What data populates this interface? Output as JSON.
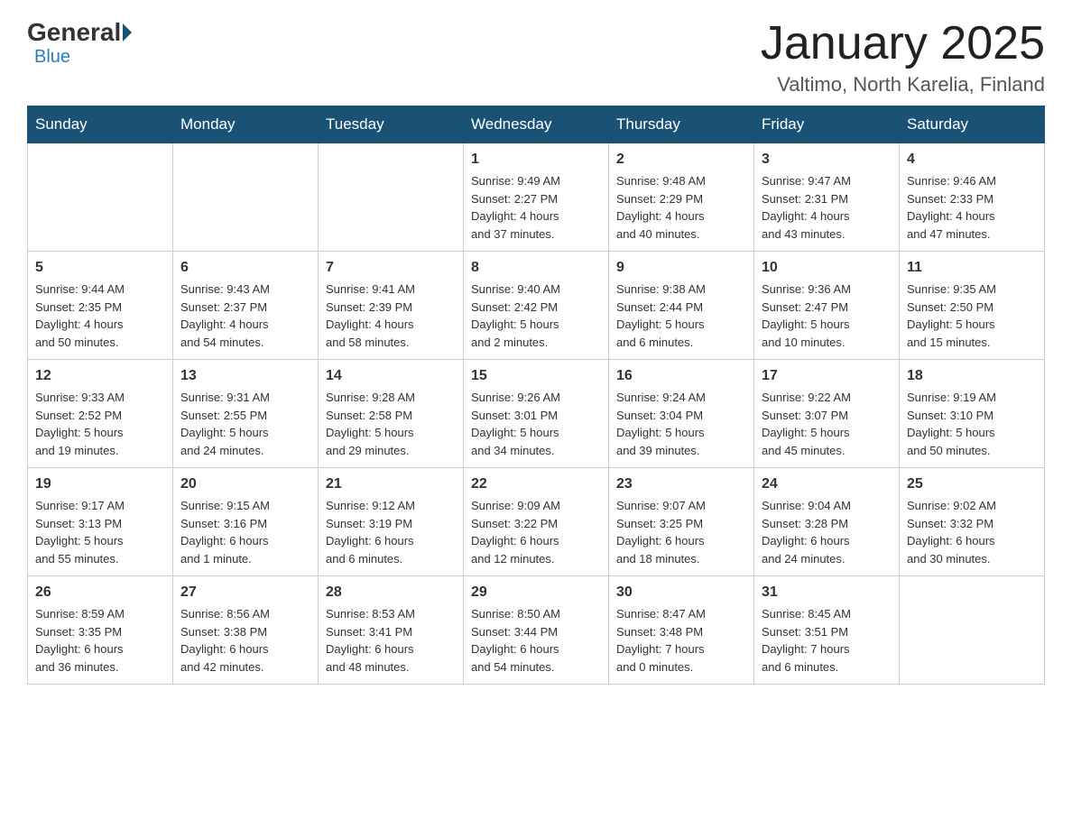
{
  "logo": {
    "general": "General",
    "blue": "Blue"
  },
  "title": "January 2025",
  "location": "Valtimo, North Karelia, Finland",
  "weekdays": [
    "Sunday",
    "Monday",
    "Tuesday",
    "Wednesday",
    "Thursday",
    "Friday",
    "Saturday"
  ],
  "weeks": [
    [
      {
        "day": "",
        "info": ""
      },
      {
        "day": "",
        "info": ""
      },
      {
        "day": "",
        "info": ""
      },
      {
        "day": "1",
        "info": "Sunrise: 9:49 AM\nSunset: 2:27 PM\nDaylight: 4 hours\nand 37 minutes."
      },
      {
        "day": "2",
        "info": "Sunrise: 9:48 AM\nSunset: 2:29 PM\nDaylight: 4 hours\nand 40 minutes."
      },
      {
        "day": "3",
        "info": "Sunrise: 9:47 AM\nSunset: 2:31 PM\nDaylight: 4 hours\nand 43 minutes."
      },
      {
        "day": "4",
        "info": "Sunrise: 9:46 AM\nSunset: 2:33 PM\nDaylight: 4 hours\nand 47 minutes."
      }
    ],
    [
      {
        "day": "5",
        "info": "Sunrise: 9:44 AM\nSunset: 2:35 PM\nDaylight: 4 hours\nand 50 minutes."
      },
      {
        "day": "6",
        "info": "Sunrise: 9:43 AM\nSunset: 2:37 PM\nDaylight: 4 hours\nand 54 minutes."
      },
      {
        "day": "7",
        "info": "Sunrise: 9:41 AM\nSunset: 2:39 PM\nDaylight: 4 hours\nand 58 minutes."
      },
      {
        "day": "8",
        "info": "Sunrise: 9:40 AM\nSunset: 2:42 PM\nDaylight: 5 hours\nand 2 minutes."
      },
      {
        "day": "9",
        "info": "Sunrise: 9:38 AM\nSunset: 2:44 PM\nDaylight: 5 hours\nand 6 minutes."
      },
      {
        "day": "10",
        "info": "Sunrise: 9:36 AM\nSunset: 2:47 PM\nDaylight: 5 hours\nand 10 minutes."
      },
      {
        "day": "11",
        "info": "Sunrise: 9:35 AM\nSunset: 2:50 PM\nDaylight: 5 hours\nand 15 minutes."
      }
    ],
    [
      {
        "day": "12",
        "info": "Sunrise: 9:33 AM\nSunset: 2:52 PM\nDaylight: 5 hours\nand 19 minutes."
      },
      {
        "day": "13",
        "info": "Sunrise: 9:31 AM\nSunset: 2:55 PM\nDaylight: 5 hours\nand 24 minutes."
      },
      {
        "day": "14",
        "info": "Sunrise: 9:28 AM\nSunset: 2:58 PM\nDaylight: 5 hours\nand 29 minutes."
      },
      {
        "day": "15",
        "info": "Sunrise: 9:26 AM\nSunset: 3:01 PM\nDaylight: 5 hours\nand 34 minutes."
      },
      {
        "day": "16",
        "info": "Sunrise: 9:24 AM\nSunset: 3:04 PM\nDaylight: 5 hours\nand 39 minutes."
      },
      {
        "day": "17",
        "info": "Sunrise: 9:22 AM\nSunset: 3:07 PM\nDaylight: 5 hours\nand 45 minutes."
      },
      {
        "day": "18",
        "info": "Sunrise: 9:19 AM\nSunset: 3:10 PM\nDaylight: 5 hours\nand 50 minutes."
      }
    ],
    [
      {
        "day": "19",
        "info": "Sunrise: 9:17 AM\nSunset: 3:13 PM\nDaylight: 5 hours\nand 55 minutes."
      },
      {
        "day": "20",
        "info": "Sunrise: 9:15 AM\nSunset: 3:16 PM\nDaylight: 6 hours\nand 1 minute."
      },
      {
        "day": "21",
        "info": "Sunrise: 9:12 AM\nSunset: 3:19 PM\nDaylight: 6 hours\nand 6 minutes."
      },
      {
        "day": "22",
        "info": "Sunrise: 9:09 AM\nSunset: 3:22 PM\nDaylight: 6 hours\nand 12 minutes."
      },
      {
        "day": "23",
        "info": "Sunrise: 9:07 AM\nSunset: 3:25 PM\nDaylight: 6 hours\nand 18 minutes."
      },
      {
        "day": "24",
        "info": "Sunrise: 9:04 AM\nSunset: 3:28 PM\nDaylight: 6 hours\nand 24 minutes."
      },
      {
        "day": "25",
        "info": "Sunrise: 9:02 AM\nSunset: 3:32 PM\nDaylight: 6 hours\nand 30 minutes."
      }
    ],
    [
      {
        "day": "26",
        "info": "Sunrise: 8:59 AM\nSunset: 3:35 PM\nDaylight: 6 hours\nand 36 minutes."
      },
      {
        "day": "27",
        "info": "Sunrise: 8:56 AM\nSunset: 3:38 PM\nDaylight: 6 hours\nand 42 minutes."
      },
      {
        "day": "28",
        "info": "Sunrise: 8:53 AM\nSunset: 3:41 PM\nDaylight: 6 hours\nand 48 minutes."
      },
      {
        "day": "29",
        "info": "Sunrise: 8:50 AM\nSunset: 3:44 PM\nDaylight: 6 hours\nand 54 minutes."
      },
      {
        "day": "30",
        "info": "Sunrise: 8:47 AM\nSunset: 3:48 PM\nDaylight: 7 hours\nand 0 minutes."
      },
      {
        "day": "31",
        "info": "Sunrise: 8:45 AM\nSunset: 3:51 PM\nDaylight: 7 hours\nand 6 minutes."
      },
      {
        "day": "",
        "info": ""
      }
    ]
  ]
}
